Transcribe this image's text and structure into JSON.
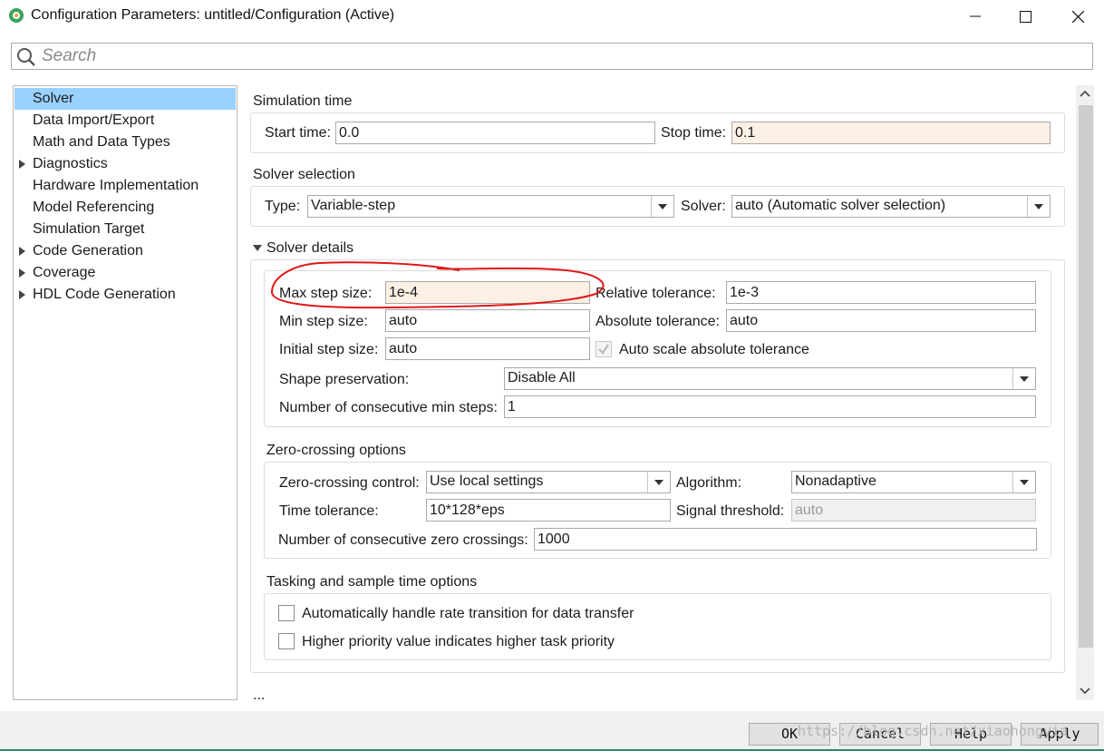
{
  "window": {
    "title": "Configuration Parameters: untitled/Configuration (Active)",
    "accent": "#99d1ff"
  },
  "search": {
    "placeholder": "Search"
  },
  "tree": {
    "items": [
      {
        "label": "Solver",
        "selected": true,
        "expandable": false
      },
      {
        "label": "Data Import/Export",
        "expandable": false
      },
      {
        "label": "Math and Data Types",
        "expandable": false
      },
      {
        "label": "Diagnostics",
        "expandable": true
      },
      {
        "label": "Hardware Implementation",
        "expandable": false
      },
      {
        "label": "Model Referencing",
        "expandable": false
      },
      {
        "label": "Simulation Target",
        "expandable": false
      },
      {
        "label": "Code Generation",
        "expandable": true
      },
      {
        "label": "Coverage",
        "expandable": true
      },
      {
        "label": "HDL Code Generation",
        "expandable": true
      }
    ]
  },
  "simulation_time": {
    "title": "Simulation time",
    "start_label": "Start time:",
    "start_value": "0.0",
    "stop_label": "Stop time:",
    "stop_value": "0.1"
  },
  "solver_selection": {
    "title": "Solver selection",
    "type_label": "Type:",
    "type_value": "Variable-step",
    "solver_label": "Solver:",
    "solver_value": "auto (Automatic solver selection)"
  },
  "solver_details": {
    "title": "Solver details",
    "max_step_label": "Max step size:",
    "max_step_value": "1e-4",
    "rel_tol_label": "Relative tolerance:",
    "rel_tol_value": "1e-3",
    "min_step_label": "Min step size:",
    "min_step_value": "auto",
    "abs_tol_label": "Absolute tolerance:",
    "abs_tol_value": "auto",
    "init_step_label": "Initial step size:",
    "init_step_value": "auto",
    "auto_scale_label": "Auto scale absolute tolerance",
    "auto_scale_checked": true,
    "shape_label": "Shape preservation:",
    "shape_value": "Disable All",
    "consec_min_label": "Number of consecutive min steps:",
    "consec_min_value": "1"
  },
  "zero_crossing": {
    "title": "Zero-crossing options",
    "control_label": "Zero-crossing control:",
    "control_value": "Use local settings",
    "algorithm_label": "Algorithm:",
    "algorithm_value": "Nonadaptive",
    "time_tol_label": "Time tolerance:",
    "time_tol_value": "10*128*eps",
    "signal_threshold_label": "Signal threshold:",
    "signal_threshold_value": "auto",
    "consec_zc_label": "Number of consecutive zero crossings:",
    "consec_zc_value": "1000"
  },
  "tasking": {
    "title": "Tasking and sample time options",
    "auto_rate_label": "Automatically handle rate transition for data transfer",
    "auto_rate_checked": false,
    "priority_label": "Higher priority value indicates higher task priority",
    "priority_checked": false
  },
  "more_label": "...",
  "buttons": {
    "ok": "OK",
    "cancel": "Cancel",
    "help": "Help",
    "apply": "Apply"
  },
  "watermark": "https://blog.csdn.net/xiaohongyia"
}
